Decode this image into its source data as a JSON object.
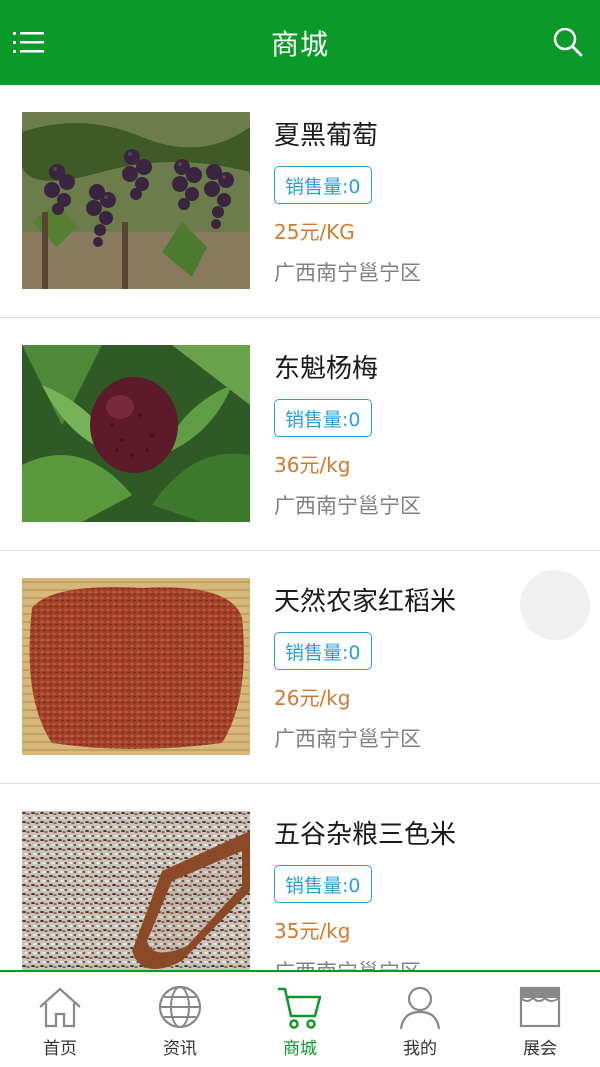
{
  "header": {
    "title": "商城",
    "menu_icon": "list-menu-icon",
    "search_icon": "search-icon"
  },
  "colors": {
    "brand": "#0b9a2a",
    "price": "#d2792e",
    "badge": "#2aa0d8"
  },
  "products": [
    {
      "name": "夏黑葡萄",
      "sales": "销售量:0",
      "price": "25元/KG",
      "location": "广西南宁邕宁区"
    },
    {
      "name": "东魁杨梅",
      "sales": "销售量:0",
      "price": "36元/kg",
      "location": "广西南宁邕宁区"
    },
    {
      "name": "天然农家红稻米",
      "sales": "销售量:0",
      "price": "26元/kg",
      "location": "广西南宁邕宁区"
    },
    {
      "name": "五谷杂粮三色米",
      "sales": "销售量:0",
      "price": "35元/kg",
      "location": "广西南宁邕宁区"
    }
  ],
  "tabs": [
    {
      "label": "首页",
      "icon": "home-icon"
    },
    {
      "label": "资讯",
      "icon": "globe-icon"
    },
    {
      "label": "商城",
      "icon": "cart-icon",
      "active": true
    },
    {
      "label": "我的",
      "icon": "user-icon"
    },
    {
      "label": "展会",
      "icon": "store-icon"
    }
  ]
}
